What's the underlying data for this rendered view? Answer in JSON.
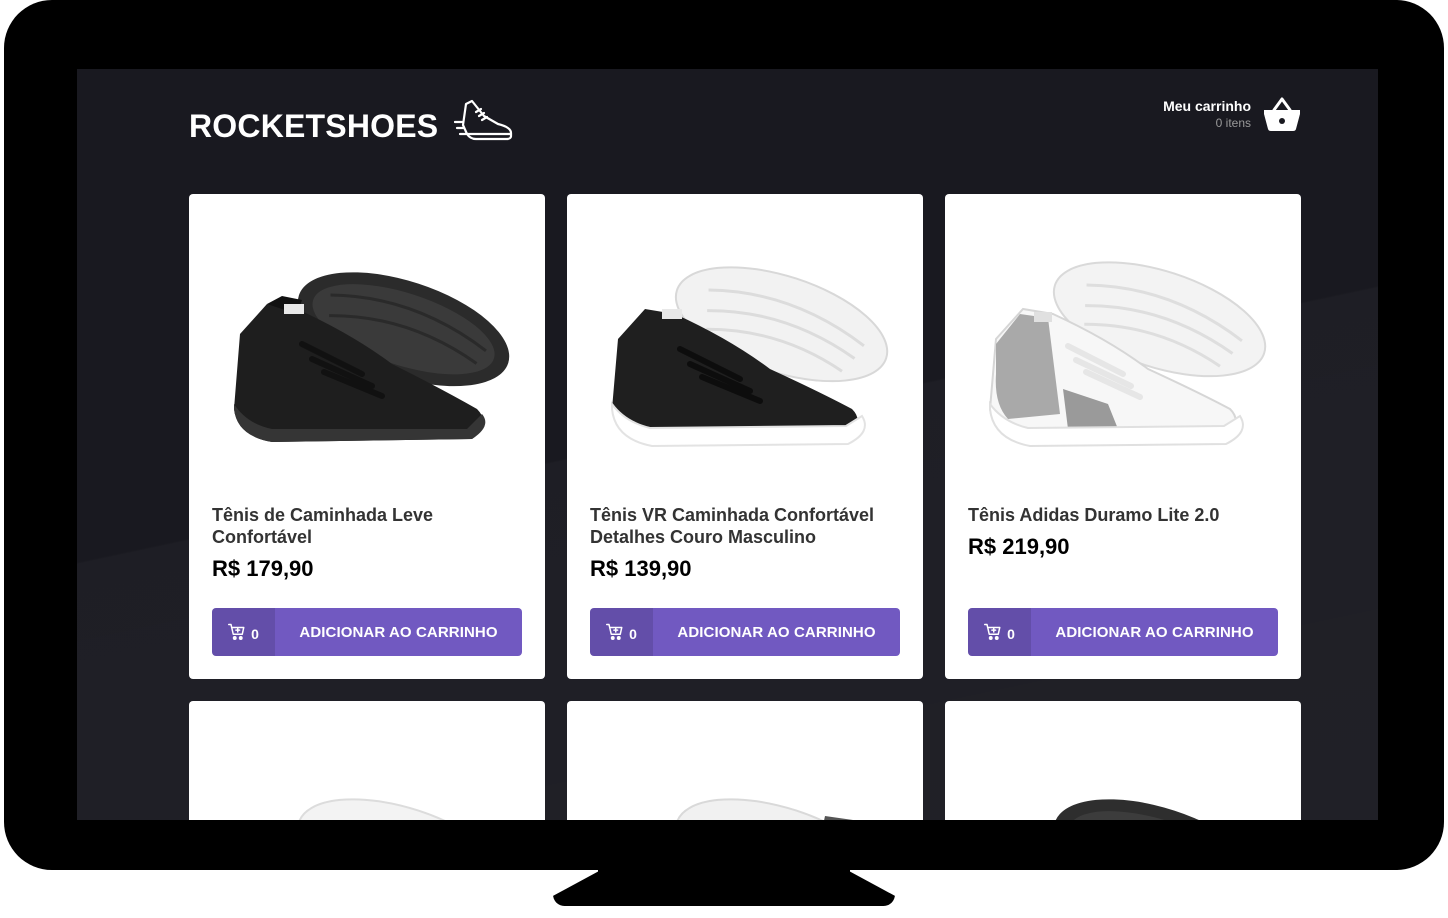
{
  "store": {
    "name": "ROCKETSHOES",
    "logo_icon": "sneaker-icon"
  },
  "cart": {
    "title": "Meu carrinho",
    "count_text": "0 itens",
    "icon": "basket-icon"
  },
  "products": [
    {
      "title": "Tênis de Caminhada Leve Confortável",
      "price": "R$ 179,90",
      "cart_amount": "0",
      "button_label": "ADICIONAR AO CARRINHO",
      "colorway": "black"
    },
    {
      "title": "Tênis VR Caminhada Confortável Detalhes Couro Masculino",
      "price": "R$ 139,90",
      "cart_amount": "0",
      "button_label": "ADICIONAR AO CARRINHO",
      "colorway": "black-white"
    },
    {
      "title": "Tênis Adidas Duramo Lite 2.0",
      "price": "R$ 219,90",
      "cart_amount": "0",
      "button_label": "ADICIONAR AO CARRINHO",
      "colorway": "white-grey"
    }
  ],
  "colors": {
    "background": "#191920",
    "accent": "#7159c1",
    "card": "#ffffff"
  }
}
